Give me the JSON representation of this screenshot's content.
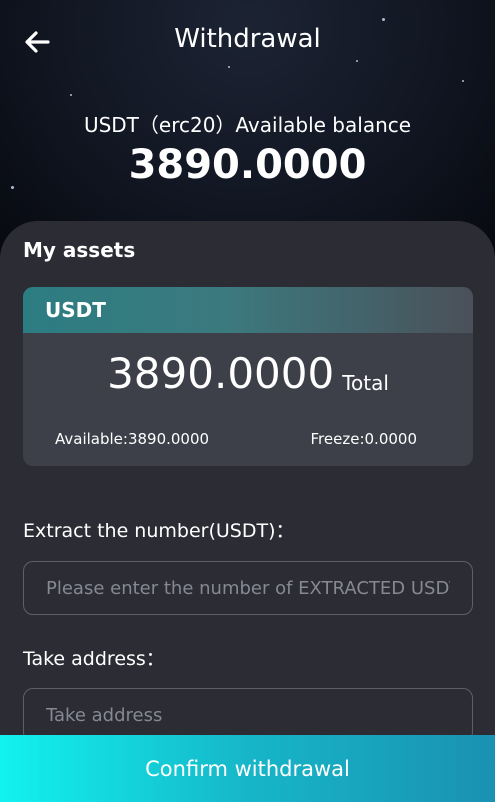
{
  "header": {
    "title": "Withdrawal",
    "back_icon": "arrow-left-icon"
  },
  "balance": {
    "label": "USDT（erc20）Available balance",
    "value": "3890.0000"
  },
  "assets": {
    "title": "My assets",
    "currency": "USDT",
    "total_value": "3890.0000",
    "total_label": "Total",
    "available_text": "Available:3890.0000",
    "freeze_text": "Freeze:0.0000"
  },
  "form": {
    "amount_label": "Extract the number(USDT)：",
    "amount_placeholder": "Please enter the number of EXTRACTED USDT",
    "amount_value": "",
    "address_label": "Take address：",
    "address_placeholder": "Take address",
    "address_value": ""
  },
  "confirm_button": {
    "label": "Confirm withdrawal"
  },
  "colors": {
    "panel": "#2b2c34",
    "card": "#3d3f49",
    "accent_start": "#12f2ef",
    "accent_end": "#1a91b1"
  }
}
